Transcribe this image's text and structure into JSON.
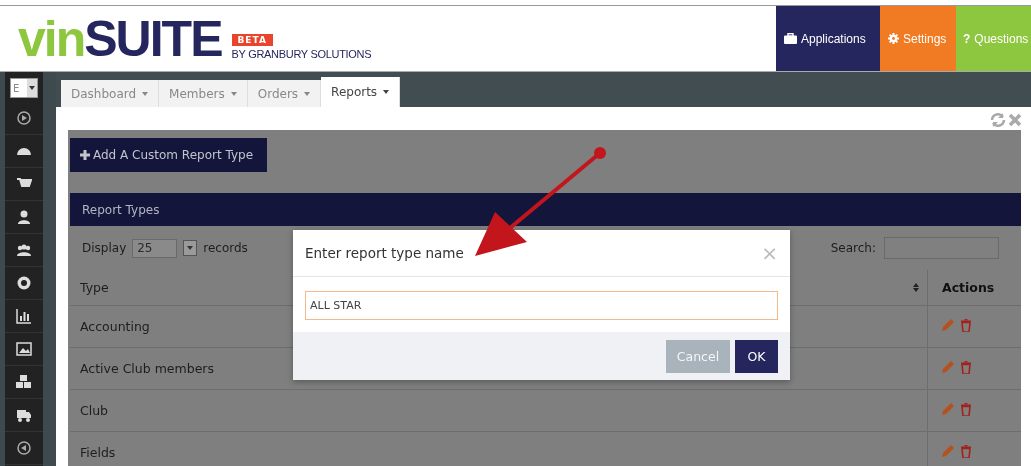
{
  "header": {
    "logo": {
      "prefix": "vin",
      "name": "SUITE"
    },
    "badge": "BETA",
    "byline": "BY GRANBURY SOLUTIONS",
    "menu": [
      {
        "kind": "briefcase",
        "label": "Applications",
        "color": "#25265e"
      },
      {
        "kind": "gear",
        "label": "Settings",
        "color": "#f07b22"
      },
      {
        "kind": "glyph",
        "glyph": "?",
        "label": "Questions",
        "color": "#8dc63f"
      }
    ]
  },
  "nav": {
    "selector": "E",
    "tabs": [
      {
        "label": "Dashboard",
        "selected": false
      },
      {
        "label": "Members",
        "selected": false
      },
      {
        "label": "Orders",
        "selected": false
      },
      {
        "label": "Reports",
        "selected": true
      }
    ]
  },
  "page": {
    "add_button": "Add A Custom Report Type",
    "panel_title": "Report Types",
    "display_label": "Display",
    "page_size": "25",
    "records_label": "records",
    "search_label": "Search:",
    "columns": [
      "Type",
      "Actions"
    ],
    "rows": [
      "Accounting",
      "Active Club members",
      "Club",
      "Fields"
    ]
  },
  "modal": {
    "title": "Enter report type name",
    "close": "×",
    "value": "ALL STAR",
    "buttons": [
      {
        "kind": "cancel",
        "label": "Cancel"
      },
      {
        "kind": "ok",
        "label": "OK"
      }
    ]
  }
}
